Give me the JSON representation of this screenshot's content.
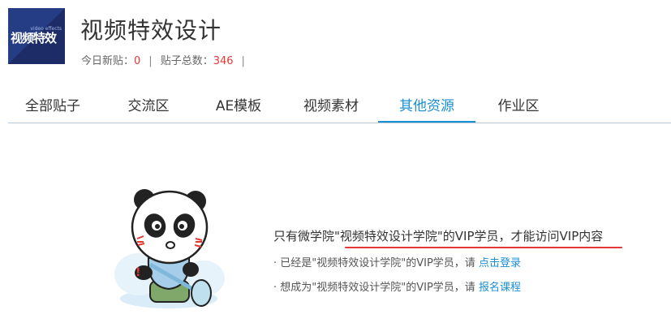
{
  "header": {
    "logo_text": "视频特效",
    "logo_subtext": "video effects",
    "title": "视频特效设计",
    "today_label": "今日新贴：",
    "today_value": "0",
    "total_label": "贴子总数：",
    "total_value": "346",
    "separator": "|"
  },
  "tabs": [
    {
      "label": "全部贴子",
      "active": false
    },
    {
      "label": "交流区",
      "active": false
    },
    {
      "label": "AE模板",
      "active": false
    },
    {
      "label": "视频素材",
      "active": false
    },
    {
      "label": "其他资源",
      "active": true
    },
    {
      "label": "作业区",
      "active": false
    }
  ],
  "notice": {
    "main": "只有微学院\"视频特效设计学院\"的VIP学员，才能访问VIP内容",
    "line1_prefix": "· 已经是\"视频特效设计学院\"的VIP学员，请 ",
    "line1_link": "点击登录",
    "line2_prefix": "· 想成为\"视频特效设计学院\"的VIP学员，请 ",
    "line2_link": "报名课程"
  },
  "colors": {
    "accent": "#1a8fd6",
    "highlight": "#e53935",
    "logo_bg": "#1d2c66"
  },
  "icons": {
    "mascot": "panda-mascot"
  }
}
